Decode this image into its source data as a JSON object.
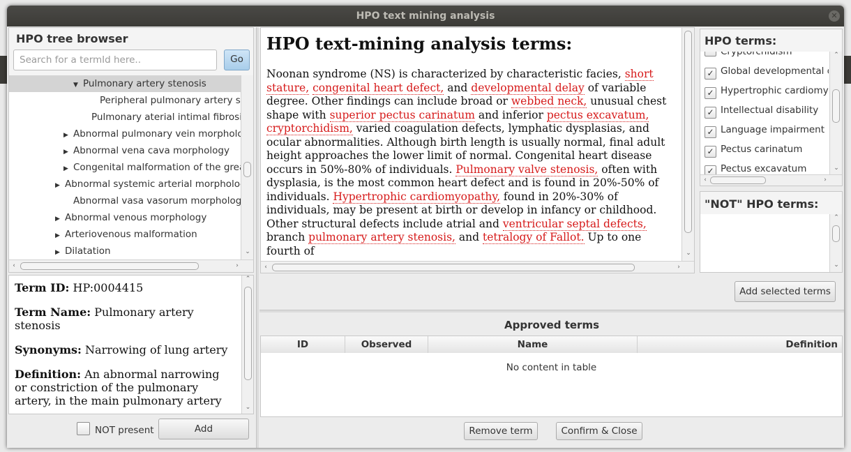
{
  "window": {
    "title": "HPO text mining analysis"
  },
  "tree": {
    "header": "HPO tree browser",
    "search_placeholder": "Search for a termId here..",
    "go_label": "Go",
    "items": [
      {
        "label": "Pulmonary artery stenosis",
        "expander": "▼",
        "selected": true
      },
      {
        "label": "Peripheral pulmonary artery sten",
        "expander": ""
      },
      {
        "label": "Pulmonary aterial intimal fibrosis",
        "expander": ""
      },
      {
        "label": "Abnormal pulmonary vein morpholog",
        "expander": "▶"
      },
      {
        "label": "Abnormal vena cava morphology",
        "expander": "▶"
      },
      {
        "label": "Congenital malformation of the great",
        "expander": "▶"
      },
      {
        "label": "Abnormal systemic arterial morphology",
        "expander": "▶"
      },
      {
        "label": "Abnormal vasa vasorum morphology",
        "expander": ""
      },
      {
        "label": "Abnormal venous morphology",
        "expander": "▶"
      },
      {
        "label": "Arteriovenous malformation",
        "expander": "▶"
      },
      {
        "label": "Dilatation",
        "expander": "▶"
      }
    ]
  },
  "details": {
    "term_id_label": "Term ID:",
    "term_id_value": "HP:0004415",
    "term_name_label": "Term Name:",
    "term_name_value": "Pulmonary artery stenosis",
    "synonyms_label": "Synonyms:",
    "synonyms_value": "Narrowing of lung artery",
    "definition_label": "Definition:",
    "definition_value": "An abnormal narrowing or constriction of the pulmonary artery, in the main pulmonary artery"
  },
  "controls": {
    "not_present_label": "NOT present",
    "add_label": "Add"
  },
  "analysis": {
    "heading": "HPO text-mining analysis terms:",
    "segments": [
      {
        "t": "Noonan syndrome (NS) is characterized by characteristic facies, ",
        "hl": false
      },
      {
        "t": "short stature,",
        "hl": true
      },
      {
        "t": " ",
        "hl": false
      },
      {
        "t": "congenital heart defect,",
        "hl": true
      },
      {
        "t": "  and ",
        "hl": false
      },
      {
        "t": "developmental delay",
        "hl": true
      },
      {
        "t": " of variable degree. Other findings can include broad or ",
        "hl": false
      },
      {
        "t": "webbed neck,",
        "hl": true
      },
      {
        "t": " unusual chest shape with ",
        "hl": false
      },
      {
        "t": "superior pectus carinatum",
        "hl": true
      },
      {
        "t": "  and inferior ",
        "hl": false
      },
      {
        "t": "pectus excavatum,",
        "hl": true
      },
      {
        "t": " ",
        "hl": false
      },
      {
        "t": "cryptorchidism,",
        "hl": true
      },
      {
        "t": " varied coagulation defects, lymphatic dysplasias, and ocular abnormalities. Although birth length is usually normal, final adult height approaches the lower limit of normal. Congenital heart disease occurs in 50%-80% of individuals. ",
        "hl": false
      },
      {
        "t": "Pulmonary valve stenosis,",
        "hl": true
      },
      {
        "t": " often with dysplasia, is the most common heart defect and is found in 20%-50% of individuals. ",
        "hl": false
      },
      {
        "t": "Hypertrophic cardiomyopathy,",
        "hl": true
      },
      {
        "t": "  found in 20%-30% of individuals, may be present at birth or develop in infancy or childhood. Other structural defects include atrial and ",
        "hl": false
      },
      {
        "t": "ventricular septal defects,",
        "hl": true
      },
      {
        "t": "  branch ",
        "hl": false
      },
      {
        "t": "pulmonary artery stenosis,",
        "hl": true
      },
      {
        "t": " and ",
        "hl": false
      },
      {
        "t": "tetralogy of Fallot.",
        "hl": true
      },
      {
        "t": " Up to one fourth of",
        "hl": false
      }
    ]
  },
  "hpo_terms": {
    "header": "HPO terms:",
    "items": [
      {
        "label": "Cryptorchidism",
        "checked": false
      },
      {
        "label": "Global developmental d",
        "checked": true
      },
      {
        "label": "Hypertrophic cardiomyo",
        "checked": true
      },
      {
        "label": "Intellectual disability",
        "checked": true
      },
      {
        "label": "Language impairment",
        "checked": true
      },
      {
        "label": "Pectus carinatum",
        "checked": true
      },
      {
        "label": "Pectus excavatum",
        "checked": true
      }
    ]
  },
  "not_terms": {
    "header": "\"NOT\" HPO terms:"
  },
  "add_selected_label": "Add selected terms",
  "approved": {
    "header": "Approved terms",
    "columns": [
      "ID",
      "Observed",
      "Name",
      "Definition"
    ],
    "empty_text": "No content in table"
  },
  "footer": {
    "remove_label": "Remove term",
    "confirm_label": "Confirm & Close"
  },
  "colors": {
    "highlight": "#d61a1a",
    "titlebar": "#3c3b37"
  }
}
